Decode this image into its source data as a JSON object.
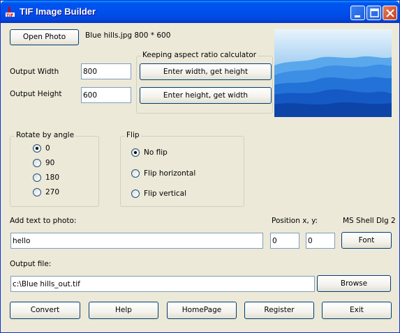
{
  "window": {
    "title": "TIF Image Builder"
  },
  "open_photo": {
    "label": "Open Photo",
    "info": "Blue hills.jpg 800 * 600"
  },
  "size": {
    "width_label": "Output Width",
    "width_value": "800",
    "height_label": "Output Height",
    "height_value": "600"
  },
  "aspect": {
    "legend": "Keeping aspect ratio calculator",
    "width_button": "Enter width, get height",
    "height_button": "Enter height, get width"
  },
  "rotate": {
    "legend": "Rotate by angle",
    "options": [
      "0",
      "90",
      "180",
      "270"
    ],
    "selected": "0"
  },
  "flip": {
    "legend": "Flip",
    "options": [
      "No flip",
      "Flip horizontal",
      "Flip vertical"
    ],
    "selected": "No flip"
  },
  "text": {
    "label": "Add text to photo:",
    "value": "hello",
    "position_label": "Position x, y:",
    "x_value": "0",
    "y_value": "0",
    "font_name": "MS Shell Dlg 2",
    "font_button": "Font"
  },
  "output": {
    "label": "Output file:",
    "value": "c:\\Blue hills_out.tif",
    "browse_button": "Browse"
  },
  "actions": {
    "convert": "Convert",
    "help": "Help",
    "homepage": "HomePage",
    "register": "Register",
    "exit": "Exit"
  },
  "colors": {
    "titlebar": "#0053EE",
    "face": "#ECE9D8",
    "button_border": "#003C74",
    "photo_sky": "#1F6FE0"
  },
  "icons": {
    "app": "tif-app-icon",
    "minimize": "minimize-icon",
    "maximize": "maximize-icon",
    "close": "close-icon"
  }
}
